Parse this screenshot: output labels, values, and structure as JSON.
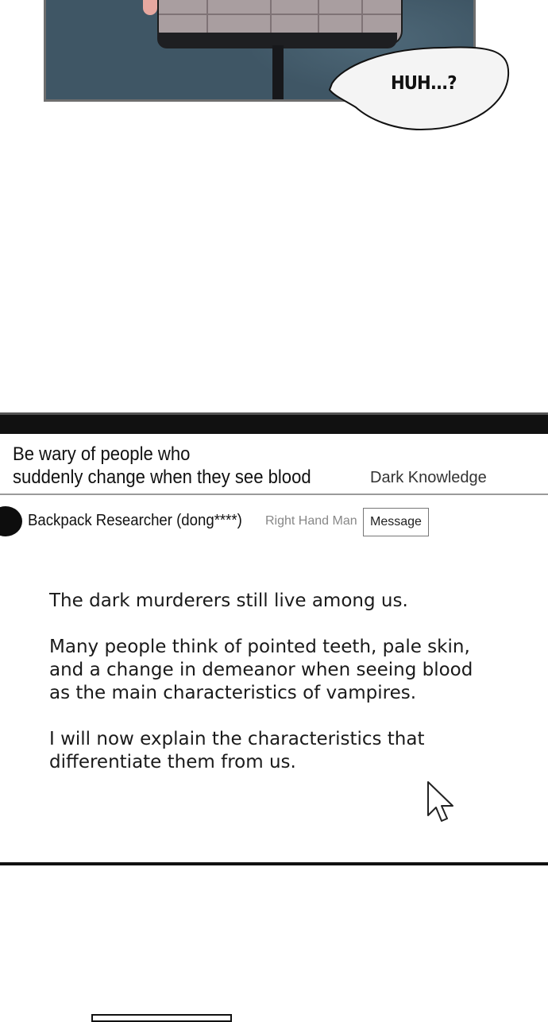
{
  "comic": {
    "speech_bubble": "HUH...?",
    "colors": {
      "background": "#3f5665",
      "shirt": "#a99ea0"
    }
  },
  "post": {
    "title_line1": "Be wary of people who",
    "title_line2": "suddenly change when they see blood",
    "category": "Dark Knowledge",
    "author": "Backpack Researcher (dong****)",
    "rank": "Right Hand Man",
    "message_button": "Message",
    "paragraphs": [
      "The dark murderers still live among us.",
      "Many people think of pointed teeth, pale skin, and a change in demeanor when seeing blood as the main characteristics of vampires.",
      "I will now explain the characteristics that differentiate them from us."
    ]
  },
  "icons": {
    "cursor": "mouse-pointer-icon",
    "avatar": "avatar-circle"
  }
}
